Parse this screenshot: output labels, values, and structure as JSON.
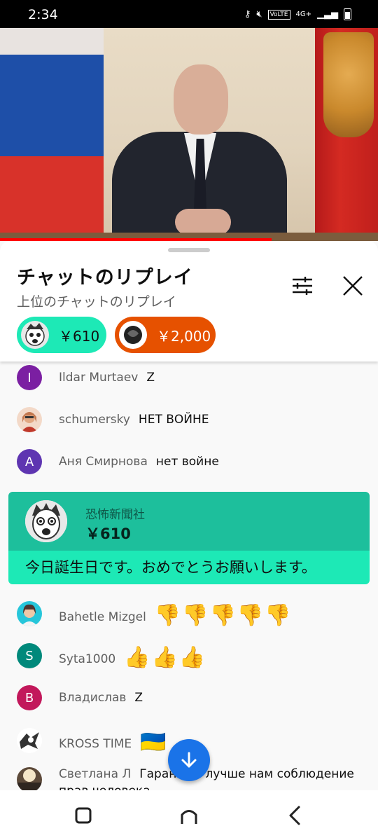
{
  "status": {
    "time": "2:34",
    "network": "4G+",
    "volte": "VoLTE"
  },
  "sheet": {
    "title": "チャットのリプレイ",
    "subtitle": "上位のチャットのリプレイ",
    "chips": [
      {
        "amount": "￥610",
        "color": "#1de9b6"
      },
      {
        "amount": "￥2,000",
        "color": "#e65100"
      }
    ]
  },
  "messages": [
    {
      "author": "Ildar Murtaev",
      "text": "Z",
      "avatar_letter": "I",
      "avatar_color": "#7b1fa2"
    },
    {
      "author": "schumersky",
      "text": "НЕТ ВОЙНЕ",
      "avatar_letter": "",
      "avatar_color": "#c2774e"
    },
    {
      "author": "Аня Смирнова",
      "text": "нет войне",
      "avatar_letter": "A",
      "avatar_color": "#5e35b1"
    },
    {
      "author": "Bahetle Mizgel",
      "text": "👎👎👎👎👎",
      "avatar_letter": "",
      "avatar_color": "#26c6da"
    },
    {
      "author": "Syta1000",
      "text": "👍👍👍",
      "avatar_letter": "S",
      "avatar_color": "#00897b"
    },
    {
      "author": "Владислав",
      "text": "Z",
      "avatar_letter": "B",
      "avatar_color": "#c2185b"
    },
    {
      "author": "KROSS TIME",
      "text": "🇺🇦",
      "avatar_letter": "",
      "avatar_color": "#ffffff"
    },
    {
      "author": "Светлана Л",
      "text": "Гарант    те лучше нам соблюдение прав человека",
      "avatar_letter": "",
      "avatar_color": "#8d6e63"
    }
  ],
  "superchat": {
    "author": "恐怖新聞社",
    "amount": "￥610",
    "message": "今日誕生日です。おめでとうお願いします。",
    "header_color": "#1dbf9c",
    "body_color": "#1de9b6"
  },
  "icons": {
    "filter": "sliders-icon",
    "close": "close-icon",
    "scroll_down": "arrow-down-icon",
    "recents": "recents-icon",
    "home": "home-icon",
    "back": "back-icon"
  },
  "colors": {
    "progress": "#ff0000",
    "fab": "#1a73e8"
  }
}
